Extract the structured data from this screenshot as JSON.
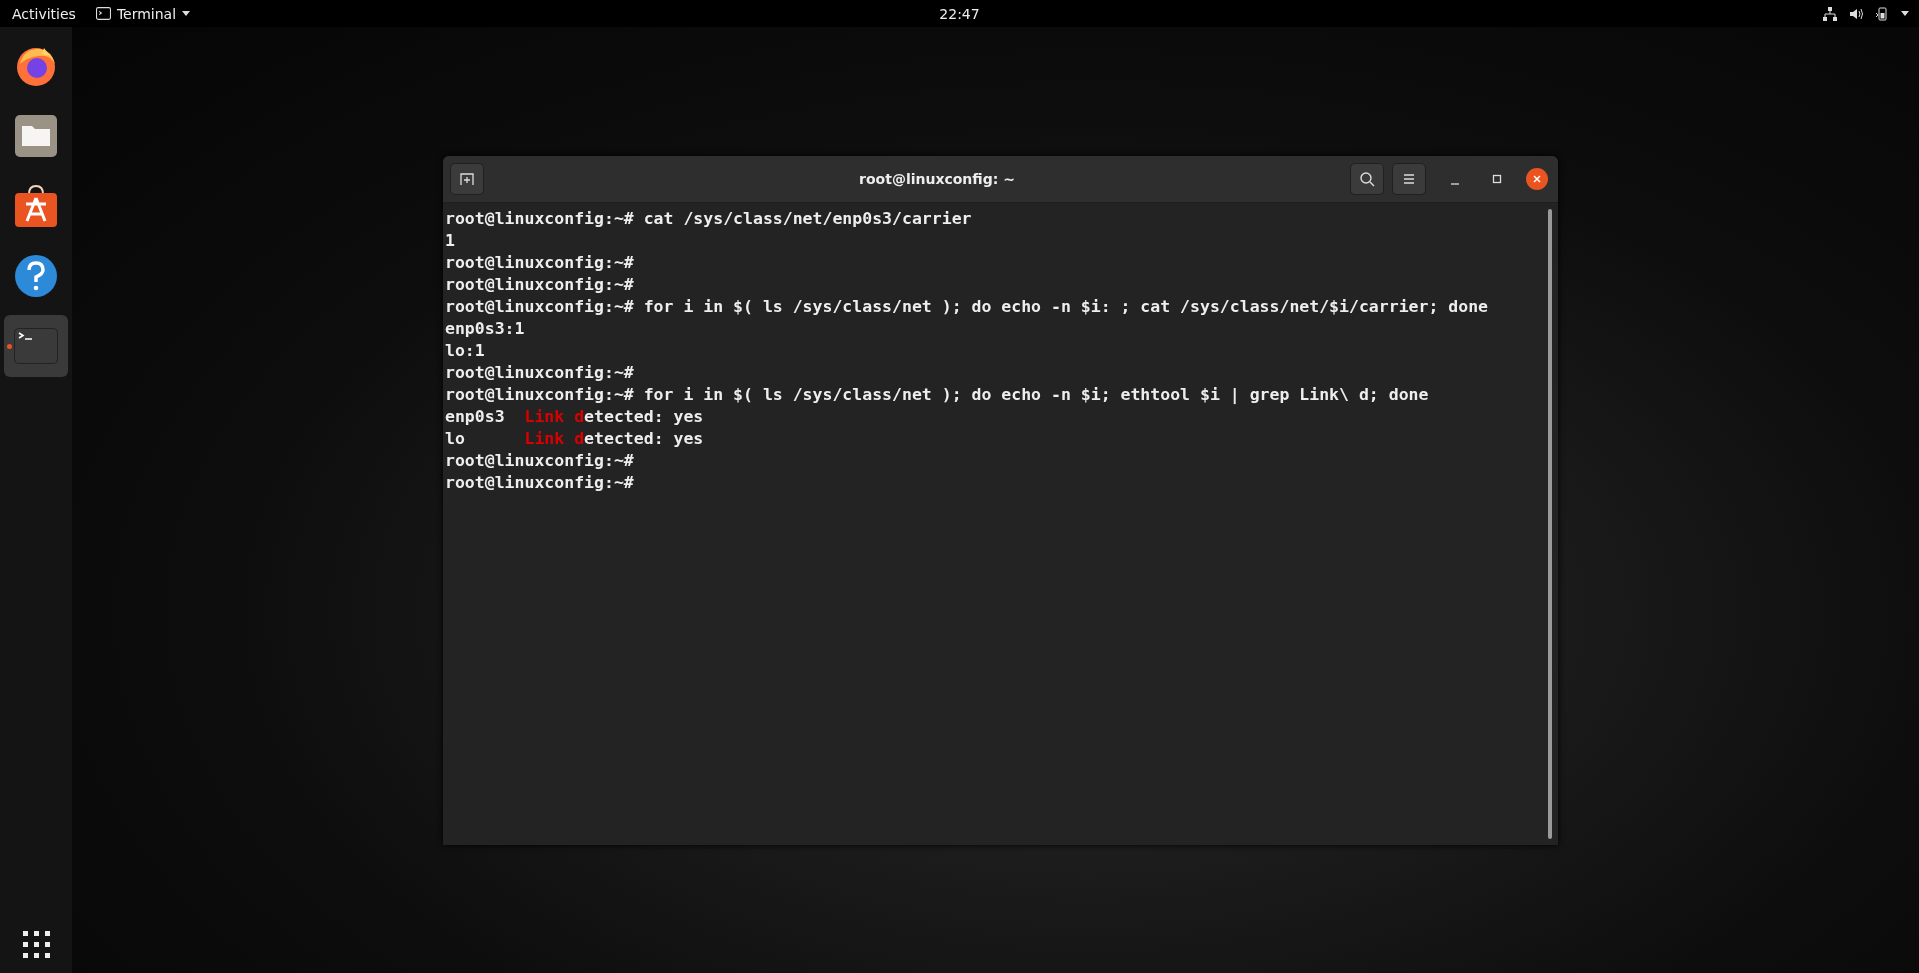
{
  "top_bar": {
    "activities": "Activities",
    "app_menu": "Terminal",
    "clock": "22:47"
  },
  "dock": {
    "items": [
      {
        "kind": "firefox",
        "selected": false,
        "running": false
      },
      {
        "kind": "files",
        "selected": false,
        "running": false
      },
      {
        "kind": "software",
        "selected": false,
        "running": false
      },
      {
        "kind": "help",
        "selected": false,
        "running": false
      },
      {
        "kind": "terminal",
        "selected": true,
        "running": true
      }
    ]
  },
  "terminal": {
    "title": "root@linuxconfig: ~",
    "lines": [
      {
        "segments": [
          {
            "text": "root@linuxconfig:~# cat /sys/class/net/enp0s3/carrier",
            "highlight": false
          }
        ]
      },
      {
        "segments": [
          {
            "text": "1",
            "highlight": false
          }
        ]
      },
      {
        "segments": [
          {
            "text": "root@linuxconfig:~#",
            "highlight": false
          }
        ]
      },
      {
        "segments": [
          {
            "text": "root@linuxconfig:~#",
            "highlight": false
          }
        ]
      },
      {
        "segments": [
          {
            "text": "root@linuxconfig:~# for i in $( ls /sys/class/net ); do echo -n $i: ; cat /sys/class/net/$i/carrier; done",
            "highlight": false
          }
        ]
      },
      {
        "segments": [
          {
            "text": "enp0s3:1",
            "highlight": false
          }
        ]
      },
      {
        "segments": [
          {
            "text": "lo:1",
            "highlight": false
          }
        ]
      },
      {
        "segments": [
          {
            "text": "root@linuxconfig:~#",
            "highlight": false
          }
        ]
      },
      {
        "segments": [
          {
            "text": "root@linuxconfig:~# for i in $( ls /sys/class/net ); do echo -n $i; ethtool $i | grep Link\\ d; done",
            "highlight": false
          }
        ]
      },
      {
        "segments": [
          {
            "text": "enp0s3  ",
            "highlight": false
          },
          {
            "text": "Link d",
            "highlight": true
          },
          {
            "text": "etected: yes",
            "highlight": false
          }
        ]
      },
      {
        "segments": [
          {
            "text": "lo      ",
            "highlight": false
          },
          {
            "text": "Link d",
            "highlight": true
          },
          {
            "text": "etected: yes",
            "highlight": false
          }
        ]
      },
      {
        "segments": [
          {
            "text": "root@linuxconfig:~#",
            "highlight": false
          }
        ]
      },
      {
        "segments": [
          {
            "text": "root@linuxconfig:~#",
            "highlight": false
          }
        ]
      }
    ]
  }
}
